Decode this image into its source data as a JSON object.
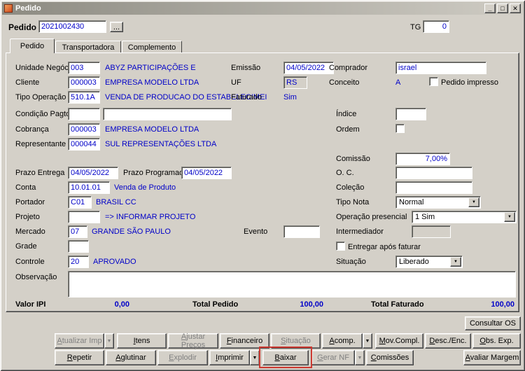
{
  "colors": {
    "window_bg": "#d4d0c8",
    "value_text": "#0000c8",
    "titlebar_from": "#8d8b82",
    "titlebar_to": "#cfccc4",
    "annotation_red": "#cd3a32"
  },
  "icons": {
    "dropdown_arrow": "▼",
    "lookup": "...",
    "minimize": "_",
    "maximize": "□",
    "close": "✕"
  },
  "window": {
    "title": "Pedido"
  },
  "header": {
    "pedido_label": "Pedido",
    "pedido_value": "2021002430",
    "tg_label": "TG",
    "tg_value": "0"
  },
  "tabs": [
    {
      "label": "Pedido"
    },
    {
      "label": "Transportadora"
    },
    {
      "label": "Complemento"
    }
  ],
  "form": {
    "unidade_negocio_label": "Unidade Negócio",
    "unidade_negocio_code": "003",
    "unidade_negocio_desc": "ABYZ PARTICIPAÇÕES E",
    "emissao_label": "Emissão",
    "emissao_value": "04/05/2022",
    "comprador_label": "Comprador",
    "comprador_value": "israel",
    "cliente_label": "Cliente",
    "cliente_code": "000003",
    "cliente_desc": "EMPRESA MODELO LTDA",
    "uf_label": "UF",
    "uf_value": "RS",
    "conceito_label": "Conceito",
    "conceito_value": "A",
    "pedido_impresso_label": "Pedido impresso",
    "tipo_operacao_label": "Tipo Operação",
    "tipo_operacao_code": "510.1A",
    "tipo_operacao_desc": "VENDA DE PRODUCAO DO ESTABELECIMEI",
    "faturado_label": "Faturado",
    "faturado_value": "Sim",
    "condicao_pagto_label": "Condição Pagto.",
    "indice_label": "Índice",
    "cobranca_label": "Cobrança",
    "cobranca_code": "000003",
    "cobranca_desc": "EMPRESA MODELO LTDA",
    "ordem_label": "Ordem",
    "representante_label": "Representante",
    "representante_code": "000044",
    "representante_desc": "SUL REPRESENTAÇÕES LTDA",
    "comissao_label": "Comissão",
    "comissao_value": "7,00%",
    "prazo_entrega_label": "Prazo Entrega",
    "prazo_entrega_value": "04/05/2022",
    "prazo_programado_label": "Prazo Programado",
    "prazo_programado_value": "04/05/2022",
    "oc_label": "O. C.",
    "conta_label": "Conta",
    "conta_code": "10.01.01",
    "conta_desc": "Venda de Produto",
    "colecao_label": "Coleção",
    "portador_label": "Portador",
    "portador_code": "C01",
    "portador_desc": "BRASIL CC",
    "tipo_nota_label": "Tipo Nota",
    "tipo_nota_value": "Normal",
    "projeto_label": "Projeto",
    "projeto_desc": "=> INFORMAR PROJETO",
    "operacao_presencial_label": "Operação presencial",
    "operacao_presencial_value": "1 Sim",
    "mercado_label": "Mercado",
    "mercado_code": "07",
    "mercado_desc": "GRANDE SÃO PAULO",
    "evento_label": "Evento",
    "intermediador_label": "Intermediador",
    "grade_label": "Grade",
    "entregar_apos_faturar_label": "Entregar após faturar",
    "controle_label": "Controle",
    "controle_code": "20",
    "controle_desc": "APROVADO",
    "situacao_label": "Situação",
    "situacao_value": "Liberado",
    "observacao_label": "Observação"
  },
  "totals": {
    "valor_ipi_label": "Valor IPI",
    "valor_ipi_value": "0,00",
    "total_pedido_label": "Total Pedido",
    "total_pedido_value": "100,00",
    "total_faturado_label": "Total Faturado",
    "total_faturado_value": "100,00"
  },
  "actions": {
    "consultar_os": "Consultar OS",
    "row1": [
      {
        "label": "Atualizar Imp",
        "disabled": true,
        "dropdown": true
      },
      {
        "label": "Itens",
        "disabled": false
      },
      {
        "label": "Ajustar Preços",
        "disabled": true
      },
      {
        "label": "Financeiro",
        "disabled": false
      },
      {
        "label": "Situação",
        "disabled": true
      },
      {
        "label": "Acomp.",
        "disabled": false,
        "dropdown": true
      },
      {
        "label": "Mov.Compl.",
        "disabled": false
      },
      {
        "label": "Desc./Enc.",
        "disabled": false
      },
      {
        "label": "Obs. Exp.",
        "disabled": false
      }
    ],
    "row2": [
      {
        "label": "Repetir",
        "disabled": false
      },
      {
        "label": "Aglutinar",
        "disabled": false
      },
      {
        "label": "Explodir",
        "disabled": true
      },
      {
        "label": "Imprimir",
        "disabled": false,
        "dropdown": true
      },
      {
        "label": "Baixar",
        "disabled": false,
        "highlighted": true
      },
      {
        "label": "Gerar NF",
        "disabled": true,
        "dropdown": true
      },
      {
        "label": "Comissões",
        "disabled": false
      },
      {
        "label": "Avaliar Margem",
        "disabled": false
      }
    ]
  }
}
